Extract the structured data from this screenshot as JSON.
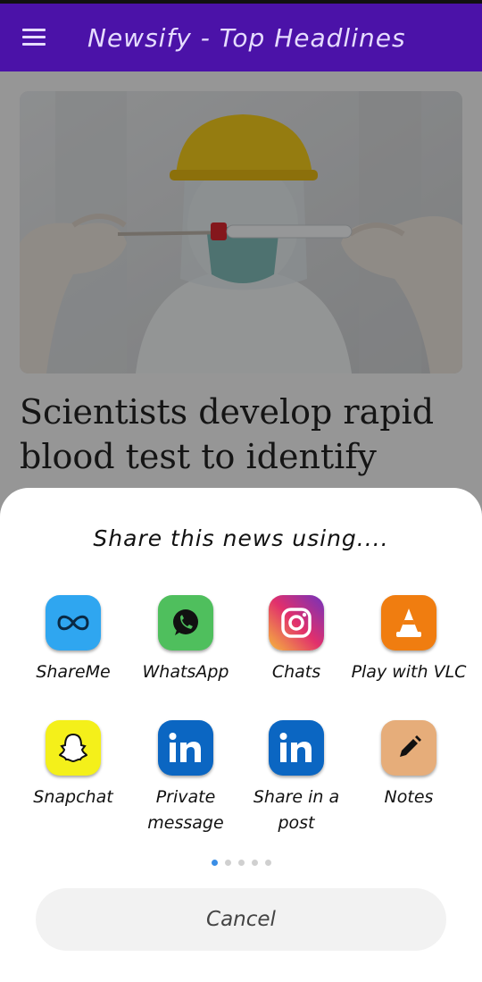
{
  "appbar": {
    "title": "Newsify - Top Headlines"
  },
  "article": {
    "headline": "Scientists develop rapid blood test to identify"
  },
  "share_sheet": {
    "title": "Share this news using....",
    "apps": [
      {
        "label": "ShareMe",
        "icon": "shareme-icon",
        "color": "#2fa6f0"
      },
      {
        "label": "WhatsApp",
        "icon": "whatsapp-icon",
        "color": "#4fbf5d"
      },
      {
        "label": "Chats",
        "icon": "instagram-icon",
        "color": "#d8336f"
      },
      {
        "label": "Play with VLC",
        "icon": "vlc-icon",
        "color": "#f07d10"
      },
      {
        "label": "Snapchat",
        "icon": "snapchat-icon",
        "color": "#f4f01a"
      },
      {
        "label": "Private message",
        "icon": "linkedin-icon",
        "color": "#0b66c2"
      },
      {
        "label": "Share in a post",
        "icon": "linkedin-icon",
        "color": "#0b66c2"
      },
      {
        "label": "Notes",
        "icon": "notes-icon",
        "color": "#e6ad7a"
      }
    ],
    "page_count": 5,
    "active_page": 1,
    "cancel_label": "Cancel"
  },
  "colors": {
    "appbar": "#4b12a8",
    "accent_dot": "#3a8ee6"
  }
}
